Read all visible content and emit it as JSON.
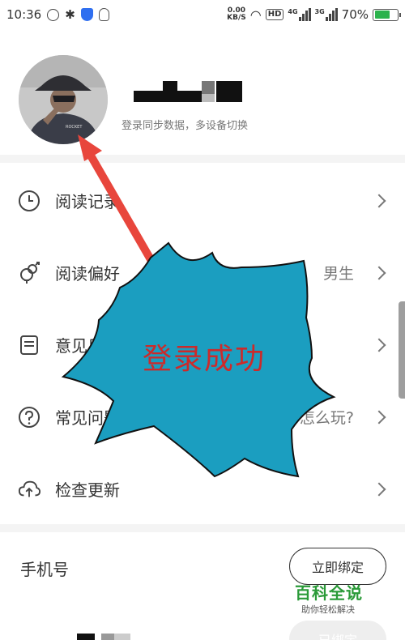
{
  "status_bar": {
    "time": "10:36",
    "net_speed_value": "0.00",
    "net_speed_unit": "KB/S",
    "hd_label": "HD",
    "signal_1_label": "4G",
    "signal_2_label": "3G",
    "battery": "70%",
    "battery_level": 0.7
  },
  "profile": {
    "login_hint": "登录同步数据，多设备切换"
  },
  "menu": [
    {
      "label": "阅读记录",
      "value": "",
      "icon": "clock-icon"
    },
    {
      "label": "阅读偏好",
      "value": "男生",
      "icon": "gender-icon"
    },
    {
      "label": "意见反馈",
      "value": "",
      "icon": "feedback-icon"
    },
    {
      "label": "常见问题",
      "value": "怎么玩?",
      "icon": "help-icon"
    },
    {
      "label": "检查更新",
      "value": "",
      "icon": "cloud-upload-icon"
    }
  ],
  "phone": {
    "label": "手机号",
    "bind_button": "立即绑定",
    "bound_button": "已绑定"
  },
  "overlay": {
    "burst_text": "登录成功",
    "burst_color": "#1b9ec0",
    "arrow_color": "#e8463c"
  },
  "watermark": {
    "title": "百科全说",
    "subtitle": "助你轻松解决"
  }
}
